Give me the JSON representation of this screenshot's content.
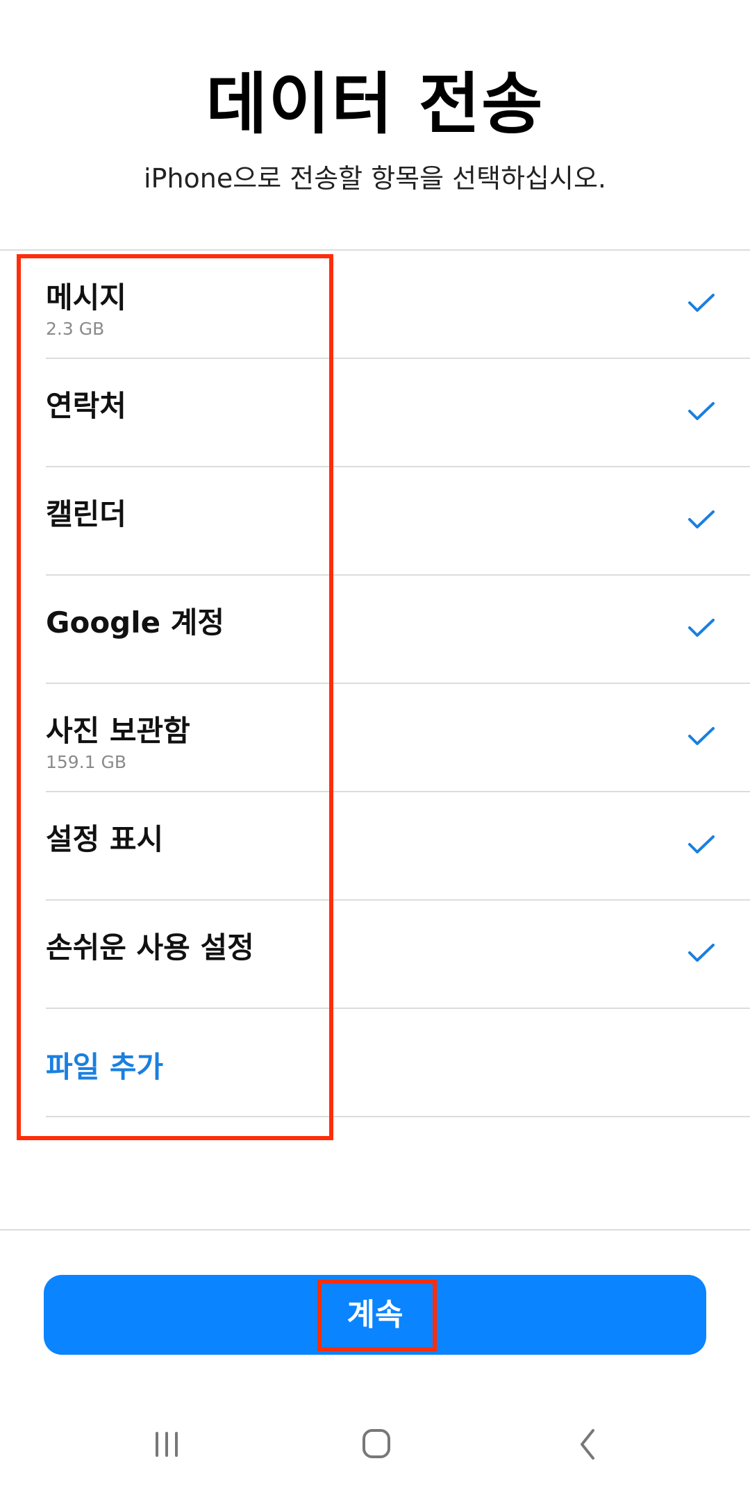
{
  "header": {
    "title": "데이터 전송",
    "subtitle": "iPhone으로 전송할 항목을 선택하십시오."
  },
  "items": [
    {
      "label": "메시지",
      "size": "2.3 GB",
      "checked": true
    },
    {
      "label": "연락처",
      "size": "",
      "checked": true
    },
    {
      "label": "캘린더",
      "size": "",
      "checked": true
    },
    {
      "label": "Google 계정",
      "size": "",
      "checked": true
    },
    {
      "label": "사진 보관함",
      "size": "159.1 GB",
      "checked": true
    },
    {
      "label": "설정 표시",
      "size": "",
      "checked": true
    },
    {
      "label": "손쉬운 사용 설정",
      "size": "",
      "checked": true
    }
  ],
  "add_files": {
    "label": "파일 추가"
  },
  "continue_button": {
    "label": "계속"
  },
  "colors": {
    "accent": "#0a84ff",
    "link": "#1a7fe0",
    "highlight": "#ff2d0a"
  },
  "navbar": {
    "icons": [
      "recent-apps-icon",
      "home-icon",
      "back-icon"
    ]
  }
}
